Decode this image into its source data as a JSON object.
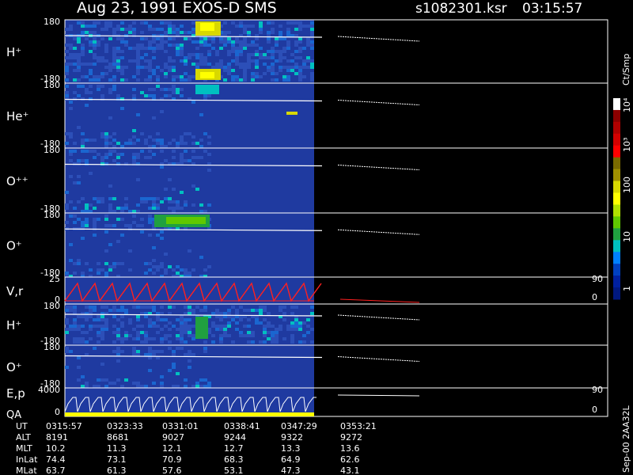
{
  "header": {
    "title": "Aug 23, 1991   EXOS-D SMS",
    "file": "s1082301.ksr",
    "time": "03:15:57"
  },
  "colorbar": {
    "label": "Ct/Smp",
    "ticks": [
      "10⁴",
      "10³",
      "100",
      "10",
      "1"
    ],
    "colors": [
      "#ffffff",
      "#8b0000",
      "#b00000",
      "#d40000",
      "#ff0000",
      "#7a6a00",
      "#a09000",
      "#d8d800",
      "#ffff00",
      "#b0e000",
      "#60c800",
      "#20a040",
      "#00c0c0",
      "#0080ff",
      "#0040c0",
      "#0020a0",
      "#001880"
    ]
  },
  "footer_note": "Sep-00 2AA32L",
  "chart_data": {
    "type": "heatmap",
    "panels": [
      {
        "label": "H⁺",
        "ytop": "180",
        "ybot": "-180"
      },
      {
        "label": "He⁺",
        "ytop": "180",
        "ybot": "-180"
      },
      {
        "label": "O⁺⁺",
        "ytop": "180",
        "ybot": "-180"
      },
      {
        "label": "O⁺",
        "ytop": "180",
        "ybot": "-180"
      },
      {
        "label": "V,r",
        "ytop": "25",
        "ybot": "0",
        "right_top": "90",
        "right_bot": "0"
      },
      {
        "label": "H⁺",
        "ytop": "180",
        "ybot": "-180"
      },
      {
        "label": "O⁺",
        "ytop": "180",
        "ybot": "-180"
      },
      {
        "label": "E,p",
        "label2": "QA",
        "ytop": "4000",
        "ybot": "0",
        "right_top": "90",
        "right_bot": "0"
      }
    ],
    "table": {
      "row_labels": [
        "UT",
        "ALT",
        "MLT",
        "InLat",
        "MLat"
      ],
      "columns": [
        [
          "0315:57",
          "8191",
          "10.2",
          "74.4",
          "63.7"
        ],
        [
          "0323:33",
          "8681",
          "11.3",
          "73.1",
          "61.3"
        ],
        [
          "0331:01",
          "9027",
          "12.1",
          "70.9",
          "57.6"
        ],
        [
          "0338:41",
          "9244",
          "12.7",
          "68.3",
          "53.1"
        ],
        [
          "0347:29",
          "9322",
          "13.3",
          "64.9",
          "47.3"
        ],
        [
          "0353:21",
          "9272",
          "13.6",
          "62.6",
          "43.1"
        ]
      ]
    }
  }
}
